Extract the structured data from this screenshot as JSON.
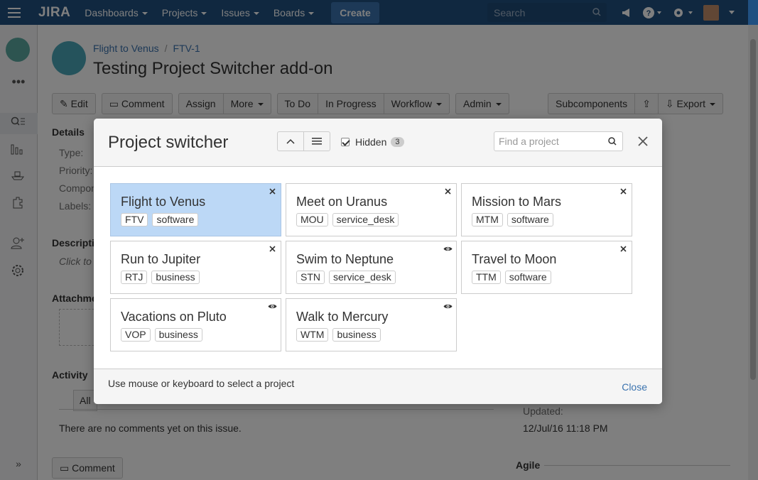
{
  "topbar": {
    "logo": "JIRA",
    "nav": [
      "Dashboards",
      "Projects",
      "Issues",
      "Boards"
    ],
    "create_label": "Create",
    "search_placeholder": "Search"
  },
  "issue": {
    "breadcrumb_project": "Flight to Venus",
    "breadcrumb_sep": "/",
    "breadcrumb_key": "FTV-1",
    "title": "Testing Project Switcher add-on",
    "ops": {
      "edit": "Edit",
      "comment": "Comment",
      "assign": "Assign",
      "more": "More",
      "todo": "To Do",
      "inprogress": "In Progress",
      "workflow": "Workflow",
      "admin": "Admin",
      "subcomponents": "Subcomponents",
      "export": "Export"
    },
    "details_label": "Details",
    "type_label": "Type:",
    "priority_label": "Priority:",
    "component_label": "Compon",
    "labels_label": "Labels:",
    "description_label": "Descripti",
    "click_to": "Click to",
    "attachments_label": "Attachme",
    "activity_label": "Activity",
    "all_tab": "All",
    "no_comments": "There are no comments yet on this issue.",
    "comment_button": "Comment",
    "updated_label": "Updated:",
    "updated_value": "12/Jul/16 11:18 PM",
    "agile_label": "Agile"
  },
  "dialog": {
    "title": "Project switcher",
    "hidden_label": "Hidden",
    "hidden_count": "3",
    "find_placeholder": "Find a project",
    "footer_hint": "Use mouse or keyboard to select a project",
    "footer_close": "Close",
    "projects": [
      {
        "name": "Flight to Venus",
        "key": "FTV",
        "type": "software",
        "icon": "remove-icon"
      },
      {
        "name": "Meet on Uranus",
        "key": "MOU",
        "type": "service_desk",
        "icon": "remove-icon"
      },
      {
        "name": "Mission to Mars",
        "key": "MTM",
        "type": "software",
        "icon": "remove-icon"
      },
      {
        "name": "Run to Jupiter",
        "key": "RTJ",
        "type": "business",
        "icon": "remove-icon"
      },
      {
        "name": "Swim to Neptune",
        "key": "STN",
        "type": "service_desk",
        "icon": "eye-icon"
      },
      {
        "name": "Travel to Moon",
        "key": "TTM",
        "type": "software",
        "icon": "remove-icon"
      },
      {
        "name": "Vacations on Pluto",
        "key": "VOP",
        "type": "business",
        "icon": "eye-icon"
      },
      {
        "name": "Walk to Mercury",
        "key": "WTM",
        "type": "business",
        "icon": "eye-icon"
      }
    ]
  },
  "colors": {
    "topbar": "#205081",
    "selected_card": "#bcd8f6",
    "link": "#3b73af"
  }
}
